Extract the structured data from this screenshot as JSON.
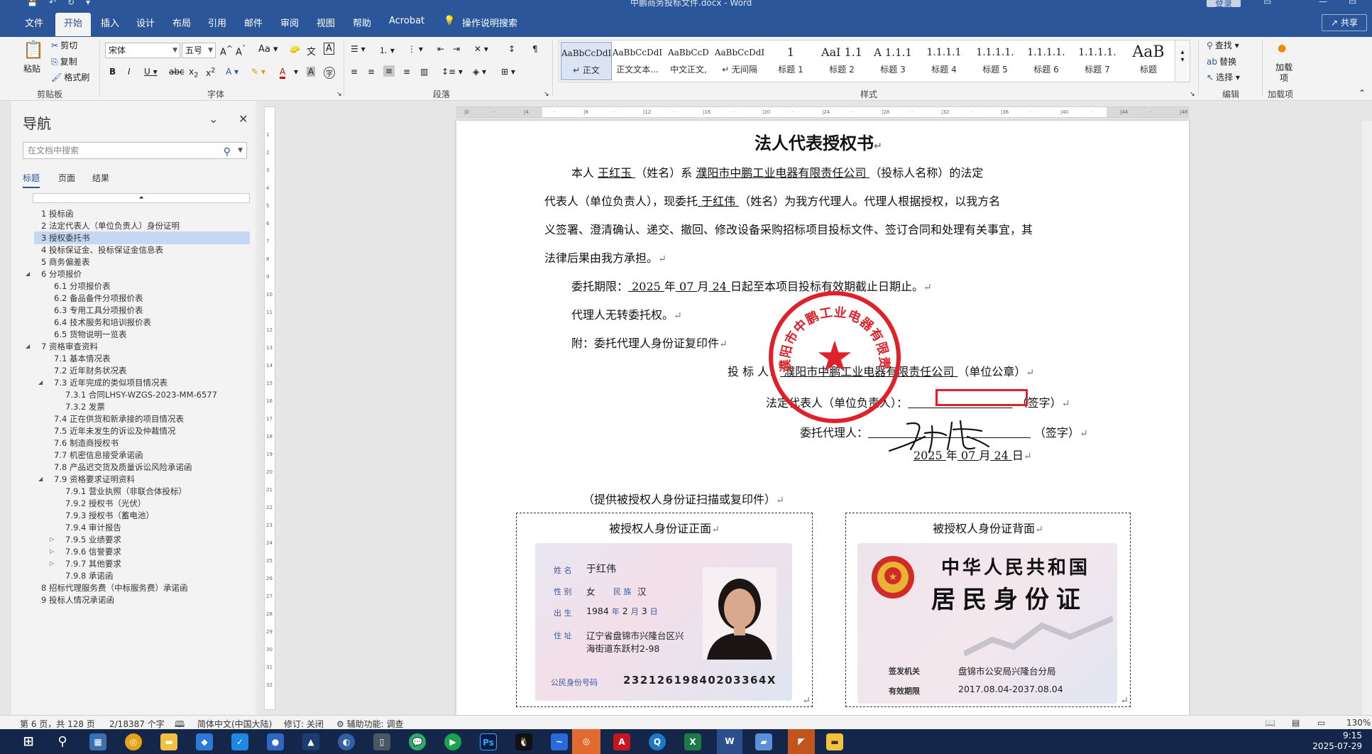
{
  "titlebar": {
    "document_name": "中鹏商务投标文件.docx - Word",
    "login": "登录"
  },
  "menu": {
    "tabs": [
      "文件",
      "开始",
      "插入",
      "设计",
      "布局",
      "引用",
      "邮件",
      "审阅",
      "视图",
      "帮助",
      "Acrobat"
    ],
    "active": "开始",
    "tell_me": "操作说明搜索",
    "share": "共享"
  },
  "ribbon": {
    "clipboard": {
      "paste": "粘贴",
      "cut": "剪切",
      "copy": "复制",
      "format_painter": "格式刷",
      "label": "剪贴板"
    },
    "font": {
      "name": "宋体",
      "size": "五号",
      "label": "字体"
    },
    "paragraph": {
      "label": "段落"
    },
    "styles": {
      "label": "样式",
      "items": [
        {
          "preview": "AaBbCcDdI",
          "name": "↵ 正文"
        },
        {
          "preview": "AaBbCcDdI",
          "name": "正文文本..."
        },
        {
          "preview": "AaBbCcD",
          "name": "中文正文,"
        },
        {
          "preview": "AaBbCcDdI",
          "name": "↵ 无间隔"
        },
        {
          "preview": "1",
          "name": "标题 1"
        },
        {
          "preview": "AaI 1.1",
          "name": "标题 2"
        },
        {
          "preview": "A 1.1.1",
          "name": "标题 3"
        },
        {
          "preview": "1.1.1.1",
          "name": "标题 4"
        },
        {
          "preview": "1.1.1.1.",
          "name": "标题 5"
        },
        {
          "preview": "1.1.1.1.",
          "name": "标题 6"
        },
        {
          "preview": "1.1.1.1.",
          "name": "标题 7"
        },
        {
          "preview": "AaB",
          "name": "标题"
        }
      ]
    },
    "editing": {
      "find": "查找",
      "replace": "替换",
      "select": "选择",
      "label": "编辑"
    },
    "addins": {
      "load": "加载项",
      "label": "加载项"
    }
  },
  "nav": {
    "title": "导航",
    "search_placeholder": "在文档中搜索",
    "tabs": [
      "标题",
      "页面",
      "结果"
    ],
    "items": [
      {
        "text": "1 投标函",
        "level": 0
      },
      {
        "text": "2 法定代表人（单位负责人）身份证明",
        "level": 0
      },
      {
        "text": "3 授权委托书",
        "level": 0,
        "selected": true
      },
      {
        "text": "4 投标保证金、投标保证金信息表",
        "level": 0
      },
      {
        "text": "5 商务偏差表",
        "level": 0
      },
      {
        "text": "6 分项报价",
        "level": 0,
        "twisty": "◢"
      },
      {
        "text": "6.1 分项报价表",
        "level": 1
      },
      {
        "text": "6.2 备品备件分项报价表",
        "level": 1
      },
      {
        "text": "6.3 专用工具分项报价表",
        "level": 1
      },
      {
        "text": "6.4 技术服务和培训报价表",
        "level": 1
      },
      {
        "text": "6.5 货物说明一览表",
        "level": 1
      },
      {
        "text": "7 资格审查资料",
        "level": 0,
        "twisty": "◢"
      },
      {
        "text": "7.1 基本情况表",
        "level": 1
      },
      {
        "text": "7.2 近年财务状况表",
        "level": 1
      },
      {
        "text": "7.3 近年完成的类似项目情况表",
        "level": 1,
        "twisty": "◢"
      },
      {
        "text": "7.3.1 合同LHSY-WZGS-2023-MM-6577",
        "level": 2
      },
      {
        "text": "7.3.2 发票",
        "level": 2
      },
      {
        "text": "7.4 正在供货和新承接的项目情况表",
        "level": 1
      },
      {
        "text": "7.5 近年未发生的诉讼及仲裁情况",
        "level": 1
      },
      {
        "text": "7.6 制造商授权书",
        "level": 1
      },
      {
        "text": "7.7 机密信息接受承诺函",
        "level": 1
      },
      {
        "text": "7.8 产品迟交货及质量诉讼风险承诺函",
        "level": 1
      },
      {
        "text": "7.9 资格要求证明资料",
        "level": 1,
        "twisty": "◢"
      },
      {
        "text": "7.9.1 营业执照（非联合体投标）",
        "level": 2
      },
      {
        "text": "7.9.2 授权书（光伏）",
        "level": 2
      },
      {
        "text": "7.9.3 授权书（蓄电池）",
        "level": 2
      },
      {
        "text": "7.9.4 审计报告",
        "level": 2
      },
      {
        "text": "7.9.5 业绩要求",
        "level": 2,
        "twisty": "▷"
      },
      {
        "text": "7.9.6 信誉要求",
        "level": 2,
        "twisty": "▷"
      },
      {
        "text": "7.9.7 其他要求",
        "level": 2,
        "twisty": "▷"
      },
      {
        "text": "7.9.8 承诺函",
        "level": 2
      },
      {
        "text": "8 招标代理服务费（中标服务费）承诺函",
        "level": 0
      },
      {
        "text": "9 投标人情况承诺函",
        "level": 0
      }
    ]
  },
  "document": {
    "title": "法人代表授权书",
    "p1_a": "本人",
    "p1_name": "   王红玉   ",
    "p1_b": "（姓名）系",
    "p1_company": "  濮阳市中鹏工业电器有限责任公司  ",
    "p1_c": "（投标人名称）的法定",
    "p2_a": "代表人（单位负责人），现委托",
    "p2_name": "  于红伟   ",
    "p2_b": "（姓名）为我方代理人。代理人根据授权，以我方名",
    "p3": "义签署、澄清确认、递交、撤回、修改设备采购招标项目投标文件、签订合同和处理有关事宜，其",
    "p4": "法律后果由我方承担。",
    "term_a": "委托期限：",
    "term_year": "   2025   ",
    "term_b": "年",
    "term_month": "   07    ",
    "term_c": "月",
    "term_day": "    24   ",
    "term_d": "日起至本项目投标有效期截止日期止。",
    "no_transfer": "代理人无转委托权。",
    "attach": "附：委托代理人身份证复印件",
    "bidder_label": "投 标 人：",
    "bidder_name": "  濮阳市中鹏工业电器有限责任公司  ",
    "bidder_seal": "（单位公章）",
    "legal_label": "法定代表人（单位负责人）：",
    "legal_sign": "（签字）",
    "agent_label": "委托代理人：",
    "agent_sign": "（签字）",
    "date_year": "  2025  ",
    "date_y": "年",
    "date_month": "   07    ",
    "date_m": "月",
    "date_day": "   24   ",
    "date_d": "日",
    "provide": "（提供被授权人身份证扫描或复印件）",
    "front_caption": "被授权人身份证正面",
    "back_caption": "被授权人身份证背面",
    "seal_text": "濮阳市中鹏工业电器有限责任公司"
  },
  "id_front": {
    "name_label": "姓 名",
    "name": "于红伟",
    "sex_label": "性 别",
    "sex": "女",
    "ethnic_label": "民 族",
    "ethnic": "汉",
    "birth_label": "出 生",
    "birth_y": "1984",
    "birth_y_u": "年",
    "birth_m": "2",
    "birth_m_u": "月",
    "birth_d": "3",
    "birth_d_u": "日",
    "addr_label": "住 址",
    "addr1": "辽宁省盘锦市兴隆台区兴",
    "addr2": "海街道东跃村2-98",
    "idno_label": "公民身份号码",
    "idno": "23212619840203364X"
  },
  "id_back": {
    "country": "中华人民共和国",
    "card": "居民身份证",
    "authority_label": "签发机关",
    "authority": "盘锦市公安局兴隆台分局",
    "valid_label": "有效期限",
    "valid": "2017.08.04-2037.08.04"
  },
  "status": {
    "page": "第 6 页，共 128 页",
    "words": "2/18387 个字",
    "lang": "简体中文(中国大陆)",
    "track": "修订: 关闭",
    "access": "辅助功能: 调查",
    "zoom": "130%"
  },
  "taskbar": {
    "time": "9:15",
    "date": "2025-07-29"
  }
}
